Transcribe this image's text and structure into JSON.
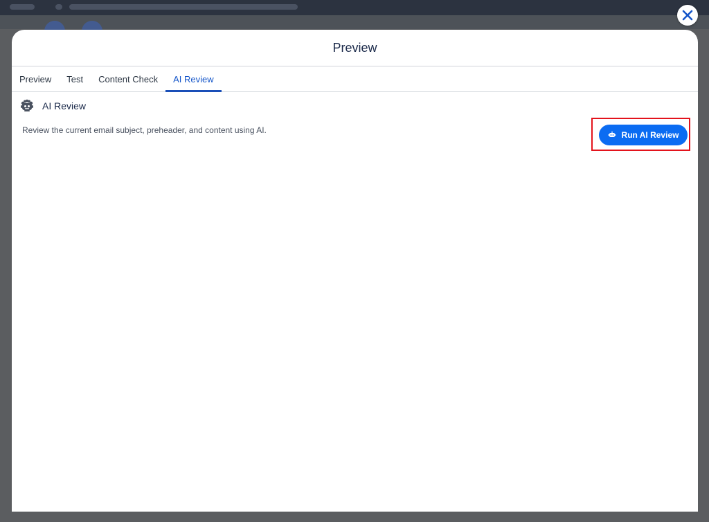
{
  "modal": {
    "title": "Preview"
  },
  "tabs": [
    {
      "label": "Preview",
      "active": false
    },
    {
      "label": "Test",
      "active": false
    },
    {
      "label": "Content Check",
      "active": false
    },
    {
      "label": "AI Review",
      "active": true
    }
  ],
  "ai_review": {
    "heading": "AI Review",
    "heading_icon": "robot-icon",
    "description": "Review the current email subject, preheader, and content using AI.",
    "run_button_label": "Run AI Review",
    "run_button_icon": "robot-icon"
  },
  "colors": {
    "accent": "#0b6cf2",
    "active_tab": "#1556c9",
    "highlight": "#e3131c"
  }
}
